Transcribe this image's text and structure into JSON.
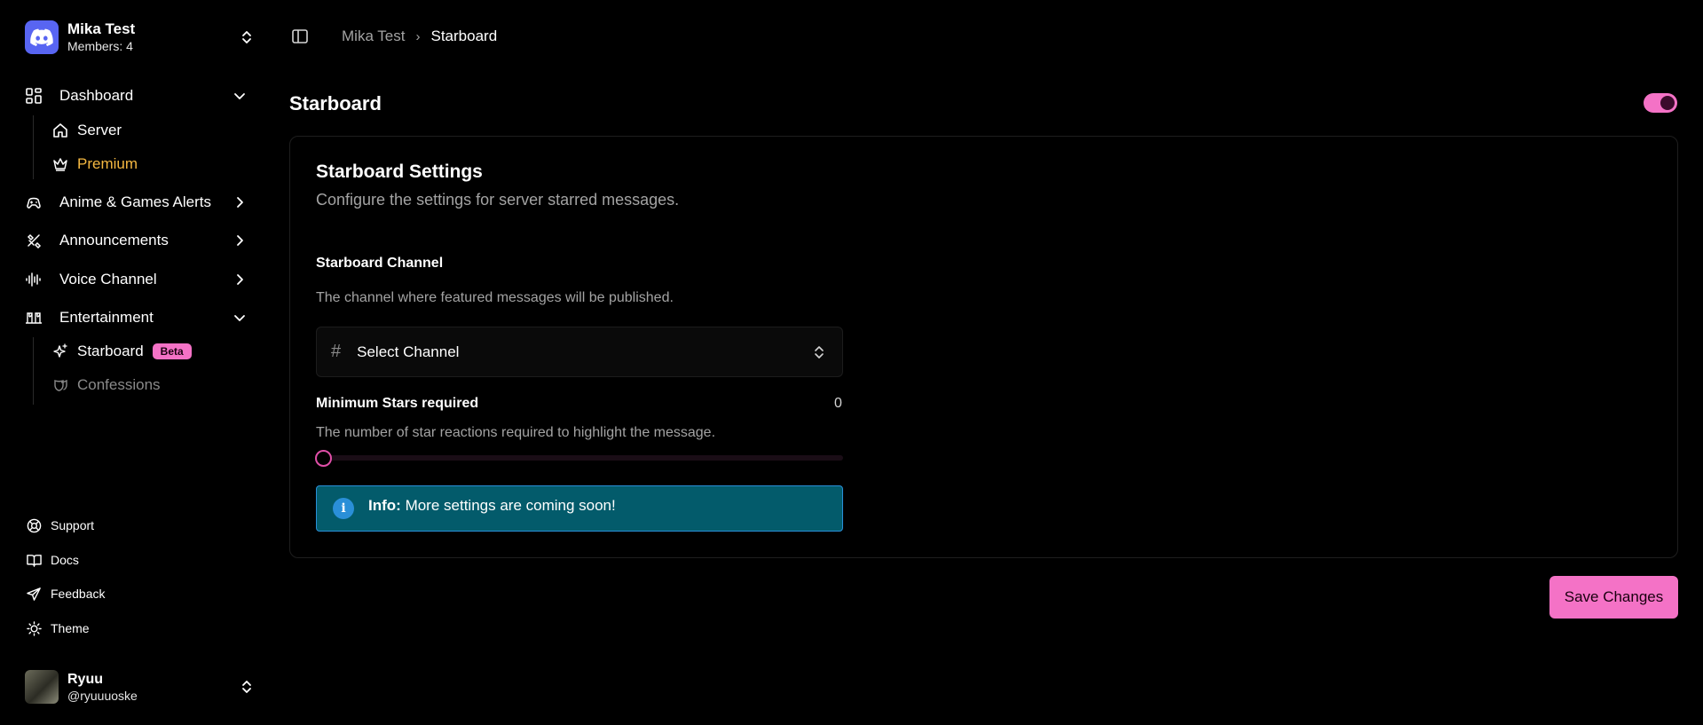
{
  "server": {
    "name": "Mika Test",
    "members": "Members: 4",
    "icon": "discord-icon"
  },
  "nav": {
    "dashboard": {
      "label": "Dashboard",
      "icon": "grid-icon",
      "expanded": true,
      "children": [
        {
          "label": "Server",
          "icon": "home-icon"
        },
        {
          "label": "Premium",
          "icon": "crown-icon",
          "color": "#f5b841"
        }
      ]
    },
    "anime": {
      "label": "Anime & Games Alerts",
      "icon": "controller-icon"
    },
    "announcements": {
      "label": "Announcements",
      "icon": "megaphone-icon"
    },
    "voice": {
      "label": "Voice Channel",
      "icon": "audio-wave-icon"
    },
    "entertainment": {
      "label": "Entertainment",
      "icon": "theater-icon",
      "expanded": true,
      "children": [
        {
          "label": "Starboard",
          "icon": "sparkles-icon",
          "badge": "Beta"
        },
        {
          "label": "Confessions",
          "icon": "mask-icon",
          "color": "#8a8a8a"
        }
      ]
    }
  },
  "footer": {
    "support": "Support",
    "docs": "Docs",
    "feedback": "Feedback",
    "theme": "Theme"
  },
  "user": {
    "name": "Ryuu",
    "handle": "@ryuuuoske"
  },
  "breadcrumb": {
    "parent": "Mika Test",
    "current": "Starboard"
  },
  "page": {
    "title": "Starboard",
    "enabled": true
  },
  "card": {
    "title": "Starboard Settings",
    "subtitle": "Configure the settings for server starred messages.",
    "channel": {
      "label": "Starboard Channel",
      "description": "The channel where featured messages will be published.",
      "placeholder": "Select Channel"
    },
    "stars": {
      "label": "Minimum Stars required",
      "value": "0",
      "description": "The number of star reactions required to highlight the message."
    },
    "info": {
      "prefix": "Info:",
      "message": "More settings are coming soon!"
    }
  },
  "actions": {
    "save": "Save Changes"
  },
  "colors": {
    "accent": "#f472c6",
    "premium": "#f5b841",
    "info_bg": "#035b6b",
    "info_border": "#2a8fd8"
  }
}
